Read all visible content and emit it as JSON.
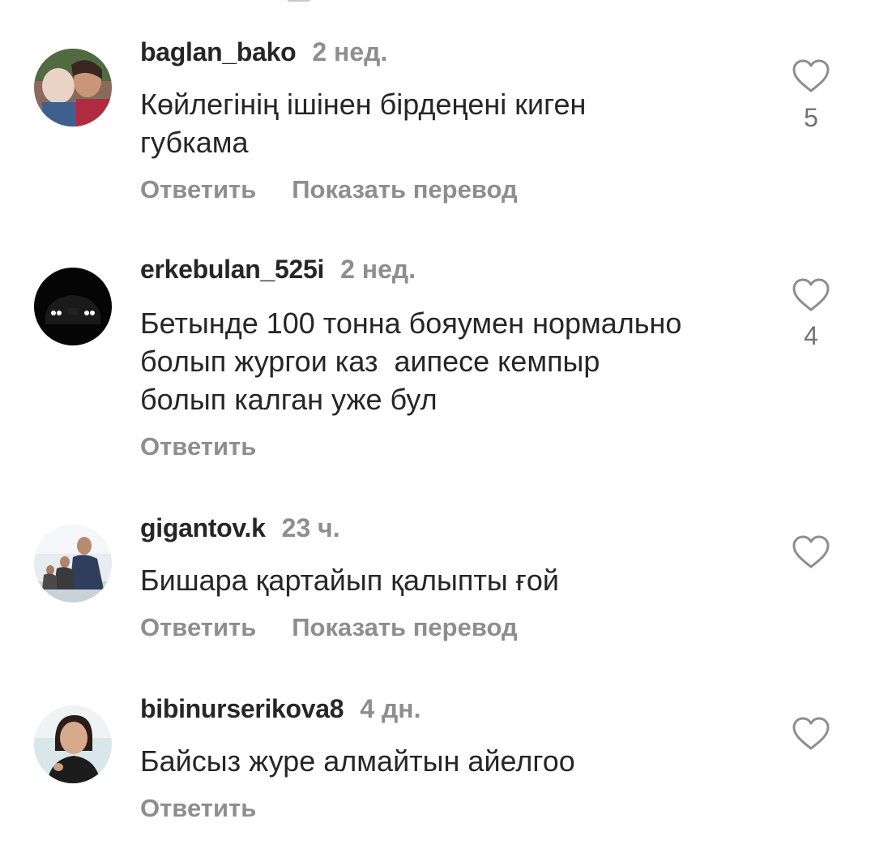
{
  "comments": [
    {
      "username": "baglan_bako",
      "time": "2 нед.",
      "text": "Көйлегінің ішінен бірдеңені киген\nгубкама",
      "reply_label": "Ответить",
      "translate_label": "Показать перевод",
      "likes": "5"
    },
    {
      "username": "erkebulan_525i",
      "time": "2 нед.",
      "text": "Бетынде 100 тонна бояумен нормально\nболып жургои каз  аипесе кемпыр\nболып калган уже бул",
      "reply_label": "Ответить",
      "likes": "4"
    },
    {
      "username": "gigantov.k",
      "time": "23 ч.",
      "text": "Бишара қартайып қалыпты ғой",
      "reply_label": "Ответить",
      "translate_label": "Показать перевод"
    },
    {
      "username": "bibinurserikova8",
      "time": "4 дн.",
      "text": "Байсыз журе алмайтын айелгоо",
      "reply_label": "Ответить"
    }
  ],
  "icons": {
    "like": "heart-outline-icon"
  },
  "colors": {
    "username": "#262626",
    "secondary_text": "#8e8e8e",
    "background": "#ffffff"
  }
}
